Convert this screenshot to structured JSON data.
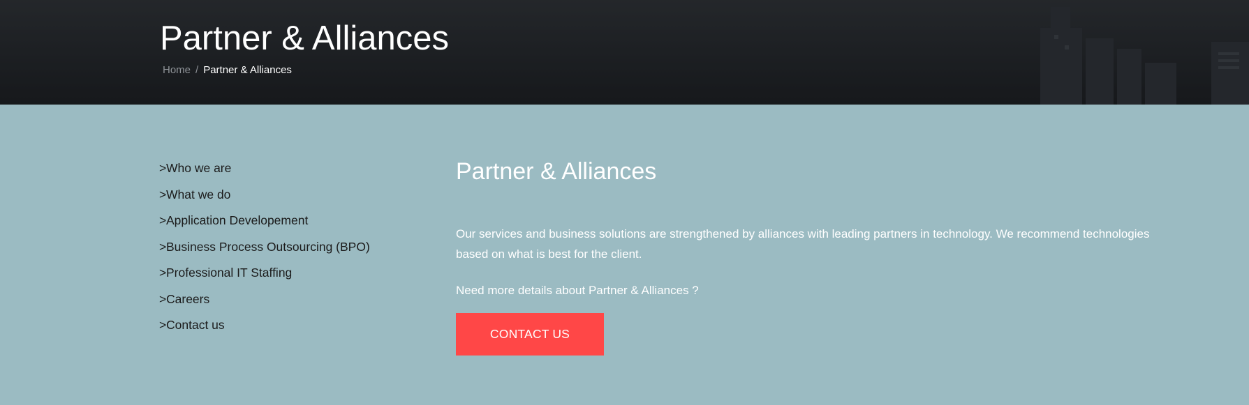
{
  "hero": {
    "title": "Partner & Alliances",
    "breadcrumb": {
      "home": "Home",
      "separator": "/",
      "current": "Partner & Alliances"
    }
  },
  "sidebar": {
    "chevron": ">",
    "items": [
      {
        "label": "Who we are"
      },
      {
        "label": "What we do"
      },
      {
        "label": "Application Developement"
      },
      {
        "label": "Business Process Outsourcing (BPO)"
      },
      {
        "label": "Professional IT Staffing"
      },
      {
        "label": "Careers"
      },
      {
        "label": "Contact us"
      }
    ]
  },
  "main": {
    "title": "Partner & Alliances",
    "intro": "Our services and business solutions are strengthened by alliances with leading partners in technology. We recommend technologies based on what is best for the client.",
    "details": "Need more details about Partner & Alliances ?",
    "cta_label": "CONTACT US"
  },
  "colors": {
    "page_background": "#9bbbc2",
    "hero_background": "#1c1f24",
    "cta_background": "#ff4747",
    "sidebar_text": "#1b1b1b",
    "main_text": "#ffffff"
  }
}
